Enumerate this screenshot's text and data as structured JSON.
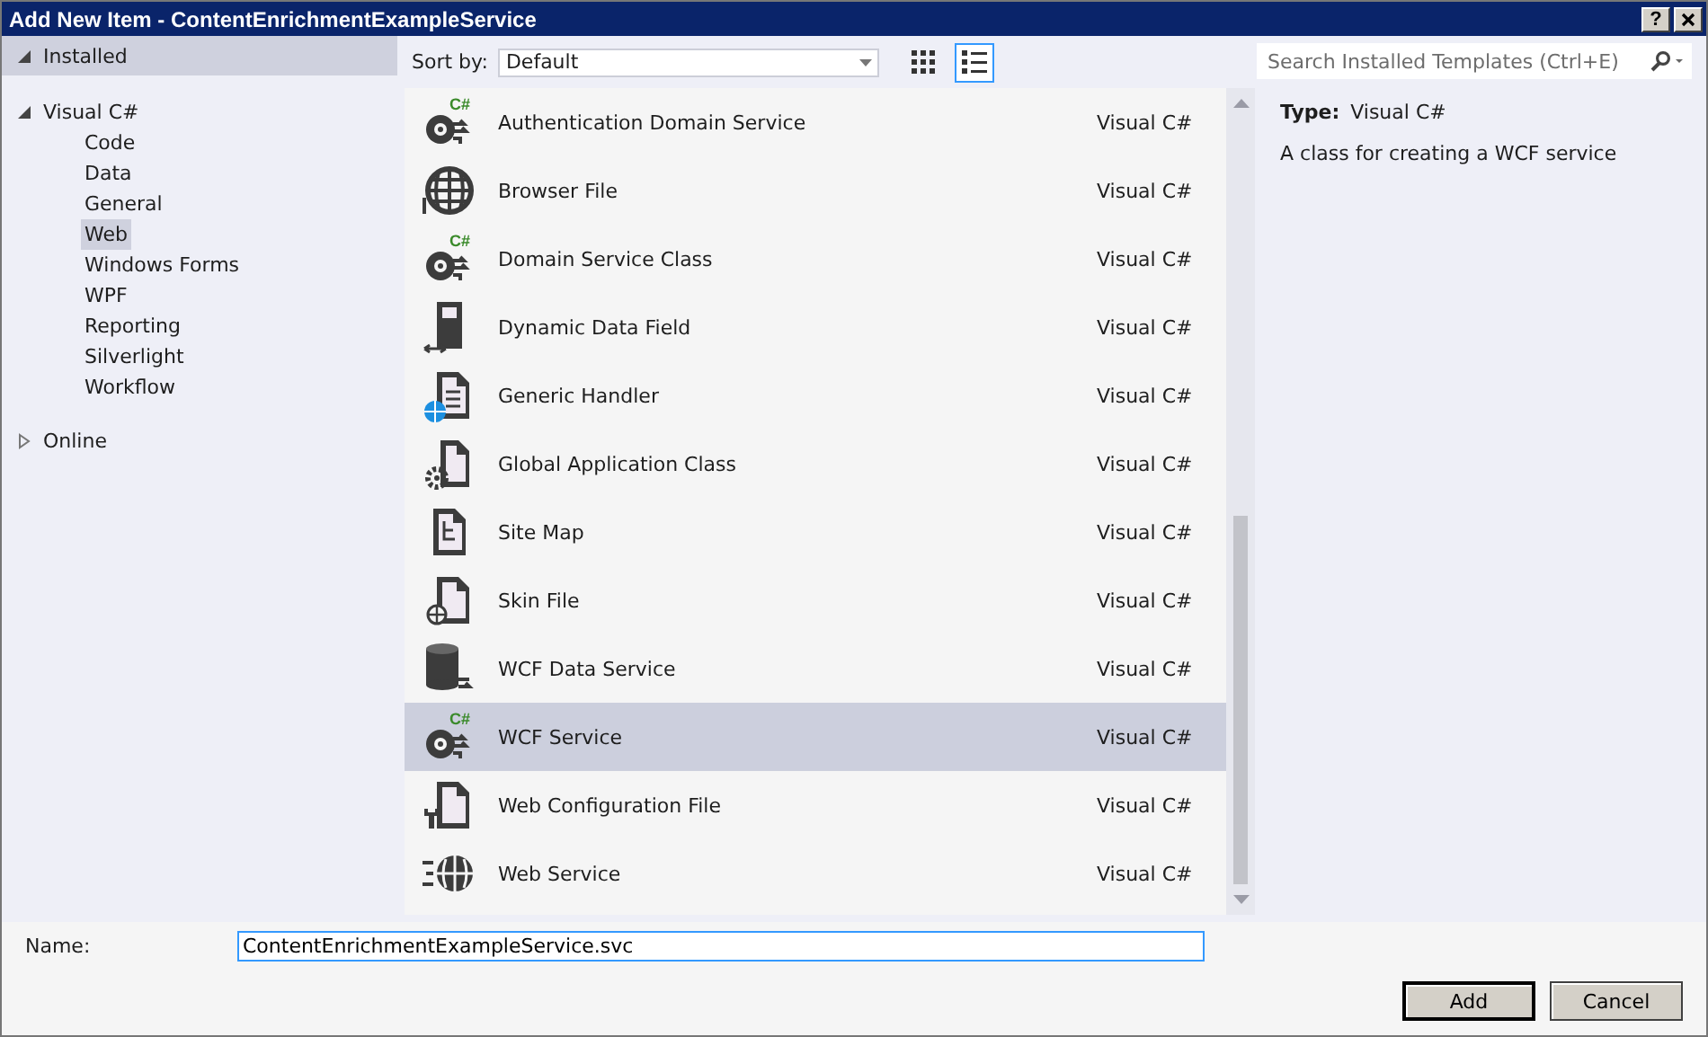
{
  "window": {
    "title": "Add New Item - ContentEnrichmentExampleService",
    "help_button": "?"
  },
  "tree": [
    {
      "label": "Installed",
      "expanded": true,
      "header": true,
      "children": [
        {
          "label": "Visual C#",
          "expanded": true,
          "children": [
            {
              "label": "Code",
              "selected": false
            },
            {
              "label": "Data",
              "selected": false
            },
            {
              "label": "General",
              "selected": false
            },
            {
              "label": "Web",
              "selected": true
            },
            {
              "label": "Windows Forms",
              "selected": false
            },
            {
              "label": "WPF",
              "selected": false
            },
            {
              "label": "Reporting",
              "selected": false
            },
            {
              "label": "Silverlight",
              "selected": false
            },
            {
              "label": "Workflow",
              "selected": false
            }
          ]
        }
      ]
    },
    {
      "label": "Online",
      "expanded": false,
      "header": false
    }
  ],
  "toolbar": {
    "sort_label": "Sort by:",
    "sort_value": "Default",
    "views": [
      {
        "kind": "grid",
        "selected": false
      },
      {
        "kind": "list",
        "selected": true
      }
    ]
  },
  "search": {
    "placeholder": "Search Installed Templates (Ctrl+E)"
  },
  "templates": [
    {
      "name": "Authentication Domain Service",
      "language": "Visual C#",
      "kind": "service",
      "badge": "C#",
      "selected": false
    },
    {
      "name": "Browser File",
      "language": "Visual C#",
      "kind": "globe",
      "selected": false
    },
    {
      "name": "Domain Service Class",
      "language": "Visual C#",
      "kind": "service",
      "badge": "C#",
      "selected": false
    },
    {
      "name": "Dynamic Data Field",
      "language": "Visual C#",
      "kind": "field",
      "selected": false
    },
    {
      "name": "Generic Handler",
      "language": "Visual C#",
      "kind": "handler",
      "selected": false
    },
    {
      "name": "Global Application Class",
      "language": "Visual C#",
      "kind": "global",
      "selected": false
    },
    {
      "name": "Site Map",
      "language": "Visual C#",
      "kind": "sitemap",
      "selected": false
    },
    {
      "name": "Skin File",
      "language": "Visual C#",
      "kind": "skin",
      "selected": false
    },
    {
      "name": "WCF Data Service",
      "language": "Visual C#",
      "kind": "database",
      "selected": false
    },
    {
      "name": "WCF Service",
      "language": "Visual C#",
      "kind": "service",
      "badge": "C#",
      "selected": true
    },
    {
      "name": "Web Configuration File",
      "language": "Visual C#",
      "kind": "config",
      "selected": false
    },
    {
      "name": "Web Service",
      "language": "Visual C#",
      "kind": "webservice",
      "selected": false
    }
  ],
  "details": {
    "type_label": "Type:",
    "type_value": "Visual C#",
    "description": "A class for creating a WCF service"
  },
  "name_field": {
    "label": "Name:",
    "value": "ContentEnrichmentExampleService.svc"
  },
  "buttons": [
    {
      "label": "Add",
      "default": true
    },
    {
      "label": "Cancel",
      "default": false
    }
  ]
}
